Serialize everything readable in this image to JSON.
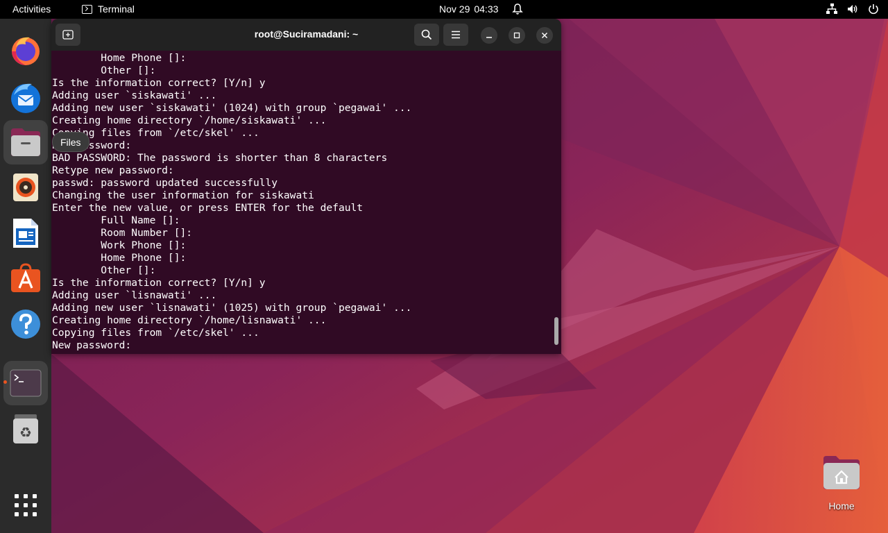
{
  "topbar": {
    "activities": "Activities",
    "app_name": "Terminal",
    "date": "Nov 29",
    "time": "04:33"
  },
  "dock": {
    "tooltip": "Files",
    "items": [
      "firefox",
      "thunderbird",
      "files",
      "rhythmbox",
      "libreoffice-writer",
      "app-center",
      "help",
      "terminal",
      "trash",
      "show-apps"
    ]
  },
  "terminal": {
    "title": "root@Suciramadani: ~",
    "lines": [
      "        Home Phone []:",
      "        Other []:",
      "Is the information correct? [Y/n] y",
      "Adding user `siskawati' ...",
      "Adding new user `siskawati' (1024) with group `pegawai' ...",
      "Creating home directory `/home/siskawati' ...",
      "Copying files from `/etc/skel' ...",
      "New password:",
      "BAD PASSWORD: The password is shorter than 8 characters",
      "Retype new password:",
      "passwd: password updated successfully",
      "Changing the user information for siskawati",
      "Enter the new value, or press ENTER for the default",
      "        Full Name []:",
      "        Room Number []:",
      "        Work Phone []:",
      "        Home Phone []:",
      "        Other []:",
      "Is the information correct? [Y/n] y",
      "Adding user `lisnawati' ...",
      "Adding new user `lisnawati' (1025) with group `pegawai' ...",
      "Creating home directory `/home/lisnawati' ...",
      "Copying files from `/etc/skel' ...",
      "New password:"
    ]
  },
  "desktop": {
    "home_label": "Home"
  },
  "colors": {
    "terminal_bg": "#300a24",
    "accent": "#e95420",
    "wallpaper_base": "#7a1f52"
  }
}
